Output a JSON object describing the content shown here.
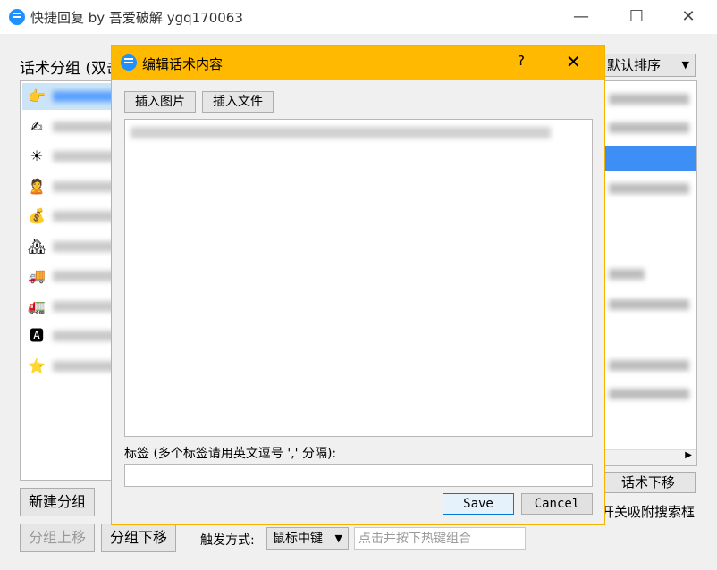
{
  "window": {
    "title": "快捷回复 by 吾爱破解 ygq170063",
    "controls": {
      "minimize": "—",
      "maximize": "☐",
      "close": "✕"
    }
  },
  "groups": {
    "label": "话术分组 (双击",
    "items": [
      {
        "icon": "pointing-hand-icon",
        "glyph": "👉",
        "selected": true
      },
      {
        "icon": "writing-hand-icon",
        "glyph": "✍",
        "selected": false
      },
      {
        "icon": "sun-icon",
        "glyph": "☀",
        "selected": false
      },
      {
        "icon": "person-icon",
        "glyph": "🙎",
        "selected": false
      },
      {
        "icon": "money-bag-icon",
        "glyph": "💰",
        "selected": false
      },
      {
        "icon": "house-icon",
        "glyph": "🏘",
        "selected": false
      },
      {
        "icon": "truck-red-icon",
        "glyph": "🚚",
        "selected": false
      },
      {
        "icon": "truck-green-icon",
        "glyph": "🚛",
        "selected": false
      },
      {
        "icon": "letter-a-icon",
        "glyph": "🅰",
        "selected": false
      },
      {
        "icon": "star-icon",
        "glyph": "⭐",
        "selected": false
      }
    ],
    "new_group_button": "新建分组",
    "move_up_button": "分组上移",
    "move_down_button": "分组下移"
  },
  "sort": {
    "selected": "默认排序"
  },
  "script_move_down_button": "话术下移",
  "snap_search_option": "开关吸附搜索框",
  "trigger": {
    "label": "触发方式:",
    "selected": "鼠标中键",
    "hotkey_placeholder": "点击并按下热键组合"
  },
  "dialog": {
    "title": "编辑话术内容",
    "help": "?",
    "close": "✕",
    "insert_image_button": "插入图片",
    "insert_file_button": "插入文件",
    "tag_label": "标签 (多个标签请用英文逗号 ',' 分隔):",
    "save_button": "Save",
    "cancel_button": "Cancel"
  },
  "colors": {
    "dialog_title_bg": "#ffb900",
    "selection": "#3d8ef5",
    "app_icon": "#1e90ff"
  }
}
